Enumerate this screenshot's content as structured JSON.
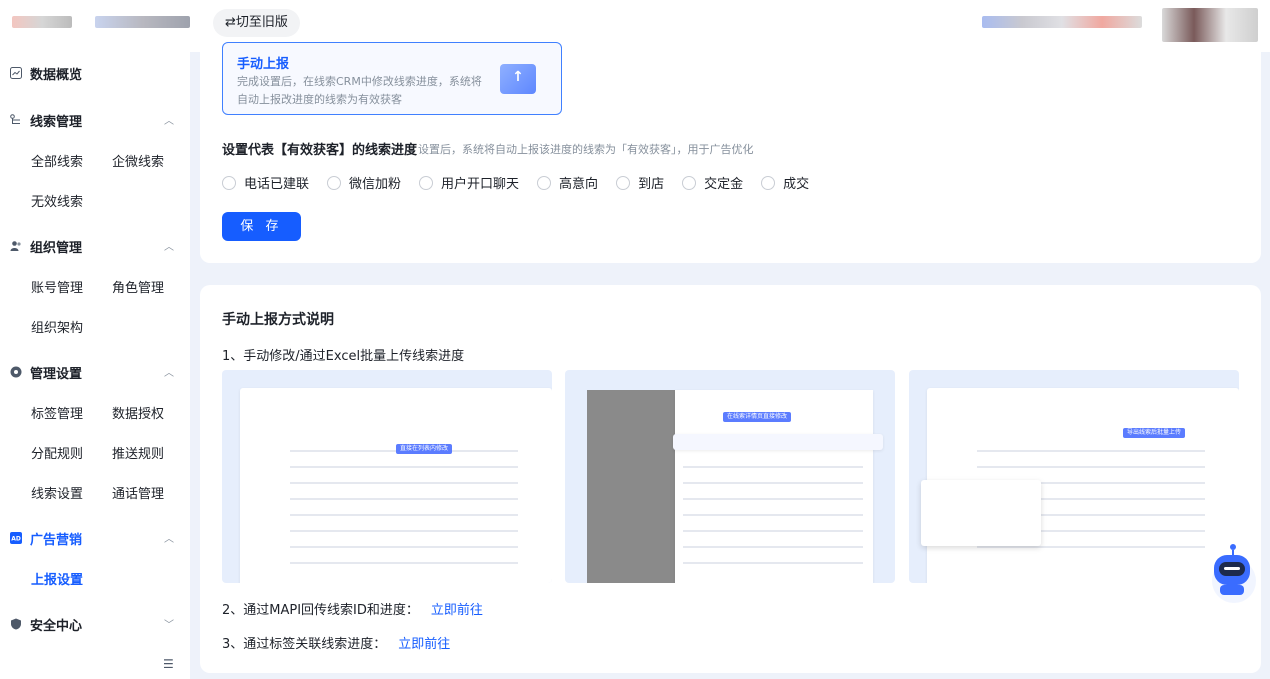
{
  "header": {
    "switch_label": "⇄切至旧版"
  },
  "sidebar": {
    "groups": [
      {
        "label": "数据概览",
        "icon": "chart-icon",
        "items": []
      },
      {
        "label": "线索管理",
        "icon": "flow-icon",
        "items": [
          "全部线索",
          "企微线索",
          "无效线索"
        ]
      },
      {
        "label": "组织管理",
        "icon": "people-icon",
        "items": [
          "账号管理",
          "角色管理",
          "组织架构"
        ]
      },
      {
        "label": "管理设置",
        "icon": "gear-icon",
        "items": [
          "标签管理",
          "数据授权",
          "分配规则",
          "推送规则",
          "线索设置",
          "通话管理"
        ]
      },
      {
        "label": "广告营销",
        "icon": "ad-icon",
        "items": [
          "上报设置"
        ]
      },
      {
        "label": "安全中心",
        "icon": "shield-icon",
        "items": []
      }
    ],
    "active_item": "上报设置"
  },
  "card1": {
    "manual_title": "手动上报",
    "manual_desc": "完成设置后，在线索CRM中修改线索进度，系统将自动上报改进度的线索为有效获客",
    "section_title": "设置代表【有效获客】的线索进度",
    "section_hint": "设置后，系统将自动上报该进度的线索为「有效获客」，用于广告优化",
    "options": [
      "电话已建联",
      "微信加粉",
      "用户开口聊天",
      "高意向",
      "到店",
      "交定金",
      "成交"
    ],
    "save_label": "保 存"
  },
  "card2": {
    "title": "手动上报方式说明",
    "line1": "1、手动修改/通过Excel批量上传线索进度",
    "line2": "2、通过MAPI回传线索ID和进度：",
    "line3": "3、通过标签关联线索进度：",
    "link_label": "立即前往",
    "shot_tags": [
      "直接在列表内修改",
      "在线索详情页直接修改",
      "导出线索后批量上传"
    ]
  },
  "colors": {
    "accent": "#165dff",
    "bg": "#eef2fa"
  }
}
